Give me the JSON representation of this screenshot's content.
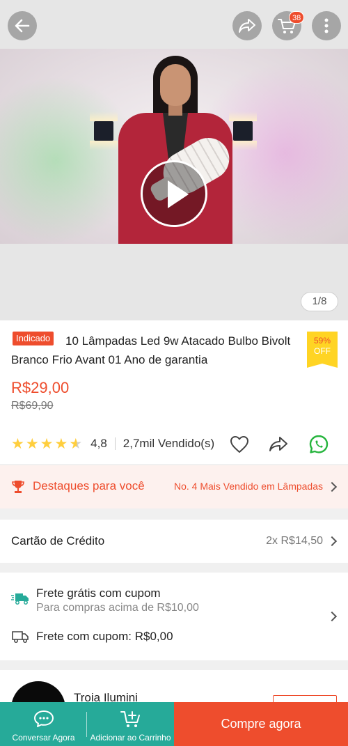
{
  "header": {
    "cart_count": "38",
    "icons": [
      "back-arrow-icon",
      "share-icon",
      "cart-icon",
      "more-vertical-icon"
    ]
  },
  "media": {
    "pager": "1/8"
  },
  "product": {
    "tag": "Indicado",
    "title": "10 Lâmpadas Led 9w Atacado Bulbo Bivolt Branco Frio Avant 01 Ano de garantia",
    "discount_percent": "59%",
    "discount_off": "OFF",
    "price": "R$29,00",
    "old_price": "R$69,90",
    "rating": "4,8",
    "rating_value": 4.8,
    "sold": "2,7mil Vendido(s)"
  },
  "highlight": {
    "label": "Destaques para você",
    "right_text": "No. 4 Mais Vendido em Lâmpadas"
  },
  "credit": {
    "label": "Cartão de Crédito",
    "value": "2x R$14,50"
  },
  "shipping": {
    "free_title": "Frete grátis com cupom",
    "free_subtitle": "Para compras acima de R$10,00",
    "coupon_line": "Frete com cupom: R$0,00"
  },
  "shop": {
    "name": "Troia Ilumini"
  },
  "bottom_bar": {
    "chat_label": "Conversar Agora",
    "add_cart_label": "Adicionar ao Carrinho",
    "buy_label": "Compre agora"
  },
  "colors": {
    "accent": "#ee4d2d",
    "teal": "#26aa99",
    "star": "#ffce3d",
    "badge_yellow": "#ffd424"
  }
}
